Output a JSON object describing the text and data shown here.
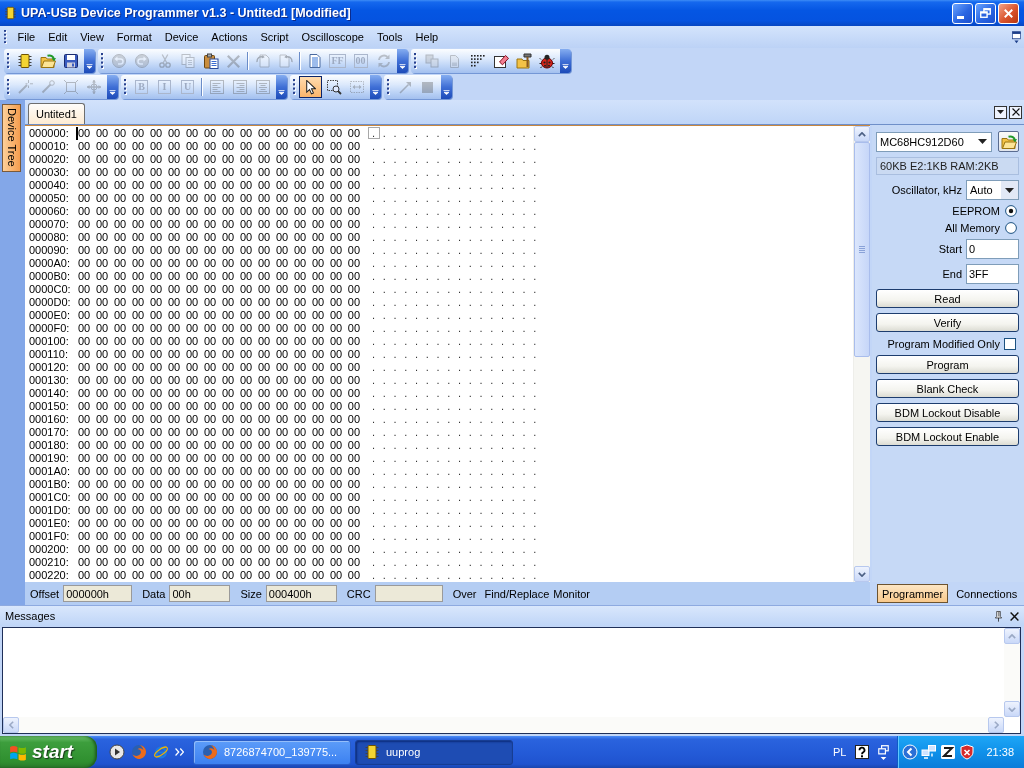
{
  "window": {
    "title": "UPA-USB Device Programmer v1.3 - Untited1 [Modified]"
  },
  "menu": [
    "File",
    "Edit",
    "View",
    "Format",
    "Device",
    "Actions",
    "Script",
    "Oscilloscope",
    "Tools",
    "Help"
  ],
  "toolbar_rows": [
    [
      {
        "groups": [
          [
            {
              "disabled": false,
              "selected": false
            },
            {
              "disabled": false,
              "selected": false
            },
            {
              "disabled": false,
              "selected": false
            }
          ]
        ]
      },
      {
        "groups": [
          [
            {
              "disabled": true,
              "selected": false
            },
            {
              "disabled": true,
              "selected": false
            },
            {
              "disabled": true,
              "selected": false
            },
            {
              "disabled": true,
              "selected": false
            },
            {
              "disabled": false,
              "selected": false
            },
            {
              "disabled": true,
              "selected": false
            }
          ],
          [
            {
              "disabled": true,
              "selected": false
            },
            {
              "disabled": true,
              "selected": false
            }
          ],
          [
            {
              "disabled": false,
              "selected": false
            },
            {
              "disabled": true,
              "selected": false,
              "label": "FF"
            },
            {
              "disabled": true,
              "selected": false,
              "label": "00"
            },
            {
              "disabled": true,
              "selected": false
            }
          ]
        ]
      },
      {
        "groups": [
          [
            {
              "disabled": true,
              "selected": false
            },
            {
              "disabled": true,
              "selected": false
            },
            {
              "disabled": false,
              "selected": false
            },
            {
              "disabled": false,
              "selected": false
            },
            {
              "disabled": false,
              "selected": false
            },
            {
              "disabled": false,
              "selected": false
            }
          ]
        ]
      }
    ],
    [
      {
        "groups": [
          [
            {
              "disabled": true,
              "selected": false
            },
            {
              "disabled": true,
              "selected": false
            },
            {
              "disabled": true,
              "selected": false
            },
            {
              "disabled": true,
              "selected": false
            }
          ]
        ]
      },
      {
        "groups": [
          [
            {
              "disabled": true,
              "selected": false,
              "label": "B"
            },
            {
              "disabled": true,
              "selected": false,
              "label": "I"
            },
            {
              "disabled": true,
              "selected": false,
              "label": "U"
            }
          ],
          [
            {
              "disabled": true,
              "selected": false
            },
            {
              "disabled": true,
              "selected": false
            },
            {
              "disabled": true,
              "selected": false
            }
          ]
        ]
      },
      {
        "groups": [
          [
            {
              "disabled": false,
              "selected": true
            },
            {
              "disabled": false,
              "selected": false
            },
            {
              "disabled": true,
              "selected": false
            }
          ]
        ]
      },
      {
        "groups": [
          [
            {
              "disabled": true,
              "selected": false
            },
            {
              "disabled": true,
              "selected": false
            }
          ]
        ]
      }
    ]
  ],
  "left_dock": {
    "tabs": [
      {
        "label": "Device Tree"
      }
    ]
  },
  "document_tabs": [
    {
      "label": "Untited1",
      "selected": true
    }
  ],
  "hex": {
    "rows": [
      {
        "address": "000000:",
        "bytes": "00 00 00 00 00 00 00 00 00 00 00 00 00 00 00 00",
        "ascii": "................",
        "cursor": true
      },
      {
        "address": "000010:",
        "bytes": "00 00 00 00 00 00 00 00 00 00 00 00 00 00 00 00",
        "ascii": "................",
        "cursor": false
      },
      {
        "address": "000020:",
        "bytes": "00 00 00 00 00 00 00 00 00 00 00 00 00 00 00 00",
        "ascii": "................",
        "cursor": false
      },
      {
        "address": "000030:",
        "bytes": "00 00 00 00 00 00 00 00 00 00 00 00 00 00 00 00",
        "ascii": "................",
        "cursor": false
      },
      {
        "address": "000040:",
        "bytes": "00 00 00 00 00 00 00 00 00 00 00 00 00 00 00 00",
        "ascii": "................",
        "cursor": false
      },
      {
        "address": "000050:",
        "bytes": "00 00 00 00 00 00 00 00 00 00 00 00 00 00 00 00",
        "ascii": "................",
        "cursor": false
      },
      {
        "address": "000060:",
        "bytes": "00 00 00 00 00 00 00 00 00 00 00 00 00 00 00 00",
        "ascii": "................",
        "cursor": false
      },
      {
        "address": "000070:",
        "bytes": "00 00 00 00 00 00 00 00 00 00 00 00 00 00 00 00",
        "ascii": "................",
        "cursor": false
      },
      {
        "address": "000080:",
        "bytes": "00 00 00 00 00 00 00 00 00 00 00 00 00 00 00 00",
        "ascii": "................",
        "cursor": false
      },
      {
        "address": "000090:",
        "bytes": "00 00 00 00 00 00 00 00 00 00 00 00 00 00 00 00",
        "ascii": "................",
        "cursor": false
      },
      {
        "address": "0000A0:",
        "bytes": "00 00 00 00 00 00 00 00 00 00 00 00 00 00 00 00",
        "ascii": "................",
        "cursor": false
      },
      {
        "address": "0000B0:",
        "bytes": "00 00 00 00 00 00 00 00 00 00 00 00 00 00 00 00",
        "ascii": "................",
        "cursor": false
      },
      {
        "address": "0000C0:",
        "bytes": "00 00 00 00 00 00 00 00 00 00 00 00 00 00 00 00",
        "ascii": "................",
        "cursor": false
      },
      {
        "address": "0000D0:",
        "bytes": "00 00 00 00 00 00 00 00 00 00 00 00 00 00 00 00",
        "ascii": "................",
        "cursor": false
      },
      {
        "address": "0000E0:",
        "bytes": "00 00 00 00 00 00 00 00 00 00 00 00 00 00 00 00",
        "ascii": "................",
        "cursor": false
      },
      {
        "address": "0000F0:",
        "bytes": "00 00 00 00 00 00 00 00 00 00 00 00 00 00 00 00",
        "ascii": "................",
        "cursor": false
      },
      {
        "address": "000100:",
        "bytes": "00 00 00 00 00 00 00 00 00 00 00 00 00 00 00 00",
        "ascii": "................",
        "cursor": false
      },
      {
        "address": "000110:",
        "bytes": "00 00 00 00 00 00 00 00 00 00 00 00 00 00 00 00",
        "ascii": "................",
        "cursor": false
      },
      {
        "address": "000120:",
        "bytes": "00 00 00 00 00 00 00 00 00 00 00 00 00 00 00 00",
        "ascii": "................",
        "cursor": false
      },
      {
        "address": "000130:",
        "bytes": "00 00 00 00 00 00 00 00 00 00 00 00 00 00 00 00",
        "ascii": "................",
        "cursor": false
      },
      {
        "address": "000140:",
        "bytes": "00 00 00 00 00 00 00 00 00 00 00 00 00 00 00 00",
        "ascii": "................",
        "cursor": false
      },
      {
        "address": "000150:",
        "bytes": "00 00 00 00 00 00 00 00 00 00 00 00 00 00 00 00",
        "ascii": "................",
        "cursor": false
      },
      {
        "address": "000160:",
        "bytes": "00 00 00 00 00 00 00 00 00 00 00 00 00 00 00 00",
        "ascii": "................",
        "cursor": false
      },
      {
        "address": "000170:",
        "bytes": "00 00 00 00 00 00 00 00 00 00 00 00 00 00 00 00",
        "ascii": "................",
        "cursor": false
      },
      {
        "address": "000180:",
        "bytes": "00 00 00 00 00 00 00 00 00 00 00 00 00 00 00 00",
        "ascii": "................",
        "cursor": false
      },
      {
        "address": "000190:",
        "bytes": "00 00 00 00 00 00 00 00 00 00 00 00 00 00 00 00",
        "ascii": "................",
        "cursor": false
      },
      {
        "address": "0001A0:",
        "bytes": "00 00 00 00 00 00 00 00 00 00 00 00 00 00 00 00",
        "ascii": "................",
        "cursor": false
      },
      {
        "address": "0001B0:",
        "bytes": "00 00 00 00 00 00 00 00 00 00 00 00 00 00 00 00",
        "ascii": "................",
        "cursor": false
      },
      {
        "address": "0001C0:",
        "bytes": "00 00 00 00 00 00 00 00 00 00 00 00 00 00 00 00",
        "ascii": "................",
        "cursor": false
      },
      {
        "address": "0001D0:",
        "bytes": "00 00 00 00 00 00 00 00 00 00 00 00 00 00 00 00",
        "ascii": "................",
        "cursor": false
      },
      {
        "address": "0001E0:",
        "bytes": "00 00 00 00 00 00 00 00 00 00 00 00 00 00 00 00",
        "ascii": "................",
        "cursor": false
      },
      {
        "address": "0001F0:",
        "bytes": "00 00 00 00 00 00 00 00 00 00 00 00 00 00 00 00",
        "ascii": "................",
        "cursor": false
      },
      {
        "address": "000200:",
        "bytes": "00 00 00 00 00 00 00 00 00 00 00 00 00 00 00 00",
        "ascii": "................",
        "cursor": false
      },
      {
        "address": "000210:",
        "bytes": "00 00 00 00 00 00 00 00 00 00 00 00 00 00 00 00",
        "ascii": "................",
        "cursor": false
      },
      {
        "address": "000220:",
        "bytes": "00 00 00 00 00 00 00 00 00 00 00 00 00 00 00 00",
        "ascii": "................",
        "cursor": false
      }
    ]
  },
  "status_bar": {
    "fields": [
      {
        "label": "Offset",
        "value": "000000h"
      },
      {
        "label": "Data",
        "value": "00h"
      },
      {
        "label": "Size",
        "value": "000400h"
      },
      {
        "label": "CRC"
      }
    ],
    "indicators": [
      "Over",
      "Find/Replace",
      "Monitor"
    ]
  },
  "programmer": {
    "device": "MC68HC912D60",
    "memory_info": "60KB E2:1KB RAM:2KB",
    "oscillator": {
      "label": "Oscillator, kHz",
      "value": "Auto"
    },
    "memory": [
      {
        "label": "EEPROM",
        "selected": true
      },
      {
        "label": "All Memory",
        "selected": false
      }
    ],
    "range": [
      {
        "label": "Start",
        "value": "0"
      },
      {
        "label": "End",
        "value": "3FF"
      }
    ],
    "actions": [
      {
        "kind": "button",
        "label": "Read"
      },
      {
        "kind": "button",
        "label": "Verify"
      },
      {
        "kind": "checkbox",
        "label": "Program Modified Only",
        "checked": false
      },
      {
        "kind": "button",
        "label": "Program"
      },
      {
        "kind": "button",
        "label": "Blank Check"
      },
      {
        "kind": "button",
        "label": "BDM Lockout Disable"
      },
      {
        "kind": "button",
        "label": "BDM Lockout Enable"
      }
    ]
  },
  "side_tabs": [
    {
      "label": "Programmer",
      "selected": true
    },
    {
      "label": "Connections",
      "selected": false
    }
  ],
  "messages": {
    "title": "Messages"
  },
  "taskbar": {
    "start": "start",
    "tasks": [
      {
        "label": "8726874700_139775...",
        "selected": false
      },
      {
        "label": "uuprog",
        "selected": true
      }
    ],
    "language": "PL",
    "clock": "21:38"
  }
}
